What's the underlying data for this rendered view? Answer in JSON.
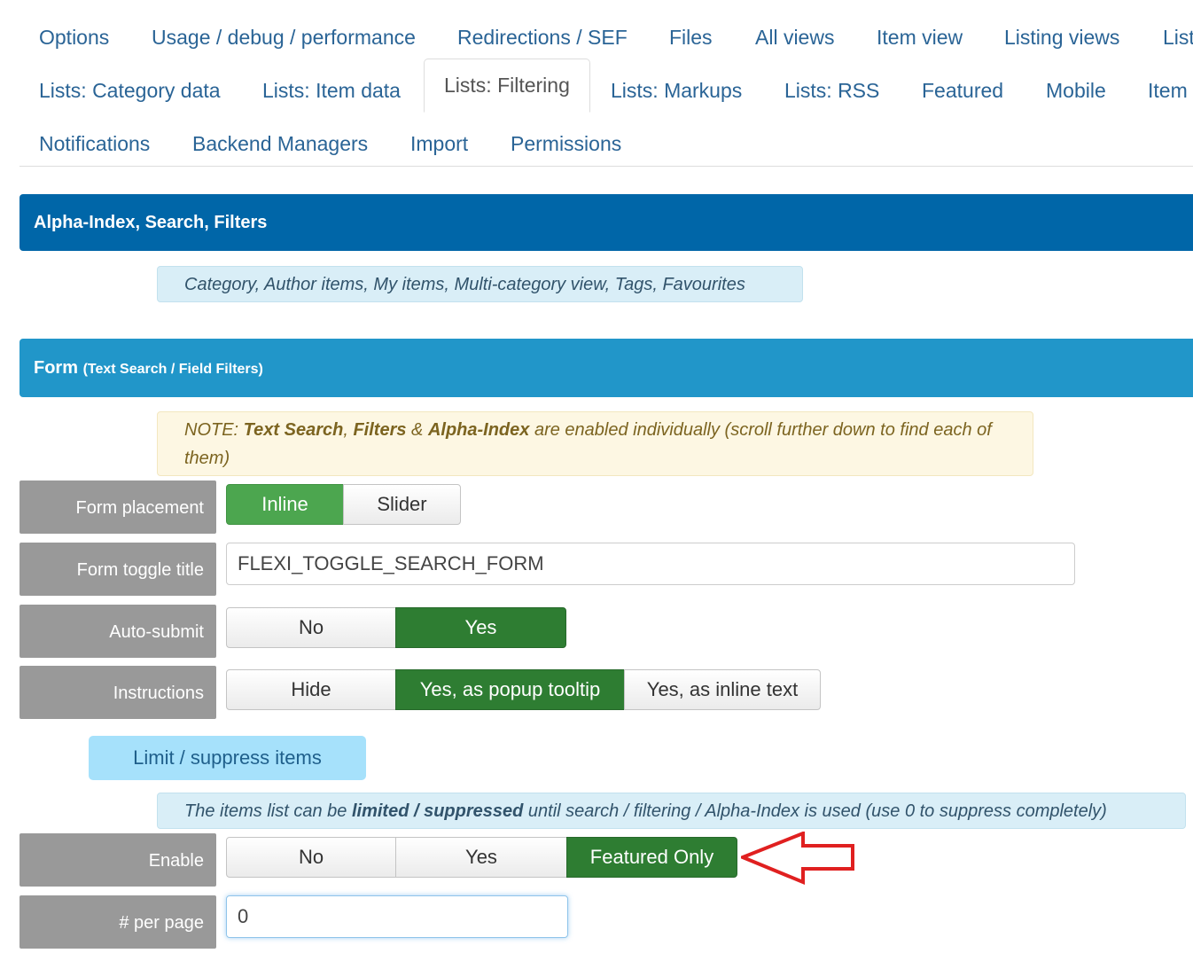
{
  "tabs": {
    "row1": [
      "Options",
      "Usage / debug / performance",
      "Redirections / SEF",
      "Files",
      "All views",
      "Item view",
      "Listing views",
      "List"
    ],
    "row2": [
      "Lists: Category data",
      "Lists: Item data",
      "Lists: Filtering",
      "Lists: Markups",
      "Lists: RSS",
      "Featured",
      "Mobile",
      "Item"
    ],
    "row3": [
      "Notifications",
      "Backend Managers",
      "Import",
      "Permissions"
    ],
    "active": "Lists: Filtering"
  },
  "sections": {
    "alpha": {
      "title": "Alpha-Index, Search, Filters",
      "note": "Category, Author items, My items, Multi-category view, Tags, Favourites"
    },
    "form": {
      "title": "Form",
      "title_small": "(Text Search / Field Filters)",
      "note_prefix": "NOTE: ",
      "note_b1": "Text Search",
      "note_sep1": ", ",
      "note_b2": "Filters",
      "note_sep2": " & ",
      "note_b3": "Alpha-Index",
      "note_suffix": " are enabled individually (scroll further down to find each of them)"
    }
  },
  "fields": {
    "placement": {
      "label": "Form placement",
      "options": [
        "Inline",
        "Slider"
      ],
      "selected": "Inline"
    },
    "toggle_title": {
      "label": "Form toggle title",
      "value": "FLEXI_TOGGLE_SEARCH_FORM"
    },
    "auto_submit": {
      "label": "Auto-submit",
      "options": [
        "No",
        "Yes"
      ],
      "selected": "Yes"
    },
    "instructions": {
      "label": "Instructions",
      "options": [
        "Hide",
        "Yes, as popup tooltip",
        "Yes, as inline text"
      ],
      "selected": "Yes, as popup tooltip"
    }
  },
  "limit": {
    "subsection_label": "Limit / suppress items",
    "note_prefix": "The items list can be ",
    "note_bold": "limited / suppressed",
    "note_suffix": " until search / filtering / Alpha-Index is used (use 0 to suppress completely)",
    "enable": {
      "label": "Enable",
      "options": [
        "No",
        "Yes",
        "Featured Only"
      ],
      "selected": "Featured Only"
    },
    "per_page": {
      "label": "# per page",
      "value": "0"
    }
  },
  "colors": {
    "header_dark": "#0066a8",
    "header_light": "#2196c9",
    "selected_green": "#2e7d32",
    "annotation_arrow": "#e02020"
  }
}
